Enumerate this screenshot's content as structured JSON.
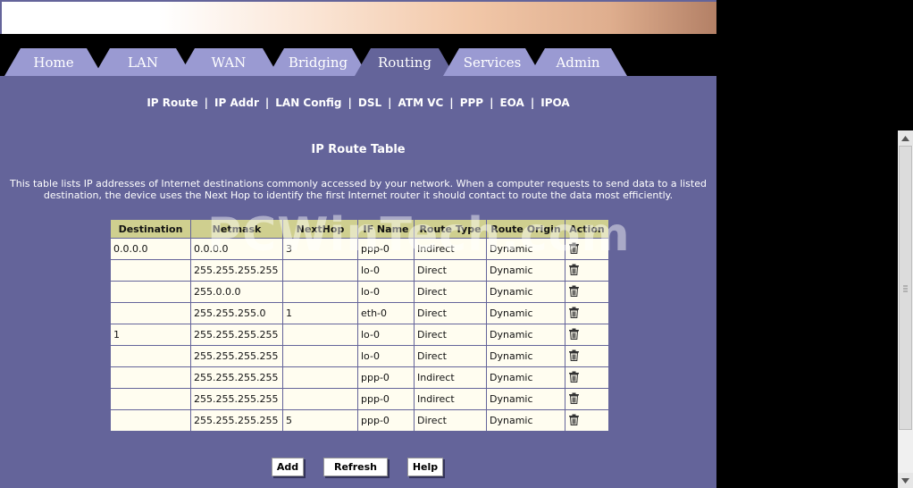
{
  "nav": {
    "tabs": [
      {
        "label": "Home",
        "active": false
      },
      {
        "label": "LAN",
        "active": false
      },
      {
        "label": "WAN",
        "active": false
      },
      {
        "label": "Bridging",
        "active": false
      },
      {
        "label": "Routing",
        "active": true
      },
      {
        "label": "Services",
        "active": false
      },
      {
        "label": "Admin",
        "active": false
      }
    ],
    "sublinks": [
      "IP Route",
      "IP Addr",
      "LAN Config",
      "DSL",
      "ATM VC",
      "PPP",
      "EOA",
      "IPOA"
    ],
    "separator": "|"
  },
  "page": {
    "title": "IP Route Table",
    "description": "This table lists IP addresses of Internet destinations commonly accessed by your network. When a computer requests to send data to a listed destination, the device uses the Next Hop to identify the first Internet router it should contact to route the data most efficiently."
  },
  "table": {
    "headers": [
      "Destination",
      "Netmask",
      "NextHop",
      "IF Name",
      "Route Type",
      "Route Origin",
      "Action"
    ],
    "rows": [
      {
        "destination": "0.0.0.0",
        "netmask": "0.0.0.0",
        "nexthop": "3",
        "ifname": "ppp-0",
        "type": "Indirect",
        "origin": "Dynamic"
      },
      {
        "destination": "",
        "netmask": "255.255.255.255",
        "nexthop": "",
        "ifname": "lo-0",
        "type": "Direct",
        "origin": "Dynamic"
      },
      {
        "destination": "",
        "netmask": "255.0.0.0",
        "nexthop": "",
        "ifname": "lo-0",
        "type": "Direct",
        "origin": "Dynamic"
      },
      {
        "destination": "",
        "netmask": "255.255.255.0",
        "nexthop": "1",
        "ifname": "eth-0",
        "type": "Direct",
        "origin": "Dynamic"
      },
      {
        "destination": "1",
        "netmask": "255.255.255.255",
        "nexthop": "",
        "ifname": "lo-0",
        "type": "Direct",
        "origin": "Dynamic"
      },
      {
        "destination": "",
        "netmask": "255.255.255.255",
        "nexthop": "",
        "ifname": "lo-0",
        "type": "Direct",
        "origin": "Dynamic"
      },
      {
        "destination": "",
        "netmask": "255.255.255.255",
        "nexthop": "",
        "ifname": "ppp-0",
        "type": "Indirect",
        "origin": "Dynamic"
      },
      {
        "destination": "",
        "netmask": "255.255.255.255",
        "nexthop": "",
        "ifname": "ppp-0",
        "type": "Indirect",
        "origin": "Dynamic"
      },
      {
        "destination": "",
        "netmask": "255.255.255.255",
        "nexthop": "5",
        "ifname": "ppp-0",
        "type": "Direct",
        "origin": "Dynamic"
      }
    ],
    "action_icon": "trash-icon"
  },
  "watermark": "PCWinTech.com",
  "buttons": {
    "add": "Add",
    "refresh": "Refresh",
    "help": "Help"
  },
  "colors": {
    "page_bg": "#64649a",
    "tab_inactive": "#9a9ad2",
    "tab_active": "#64649a",
    "table_header": "#cfcf8f",
    "table_cell": "#fffdf0"
  }
}
